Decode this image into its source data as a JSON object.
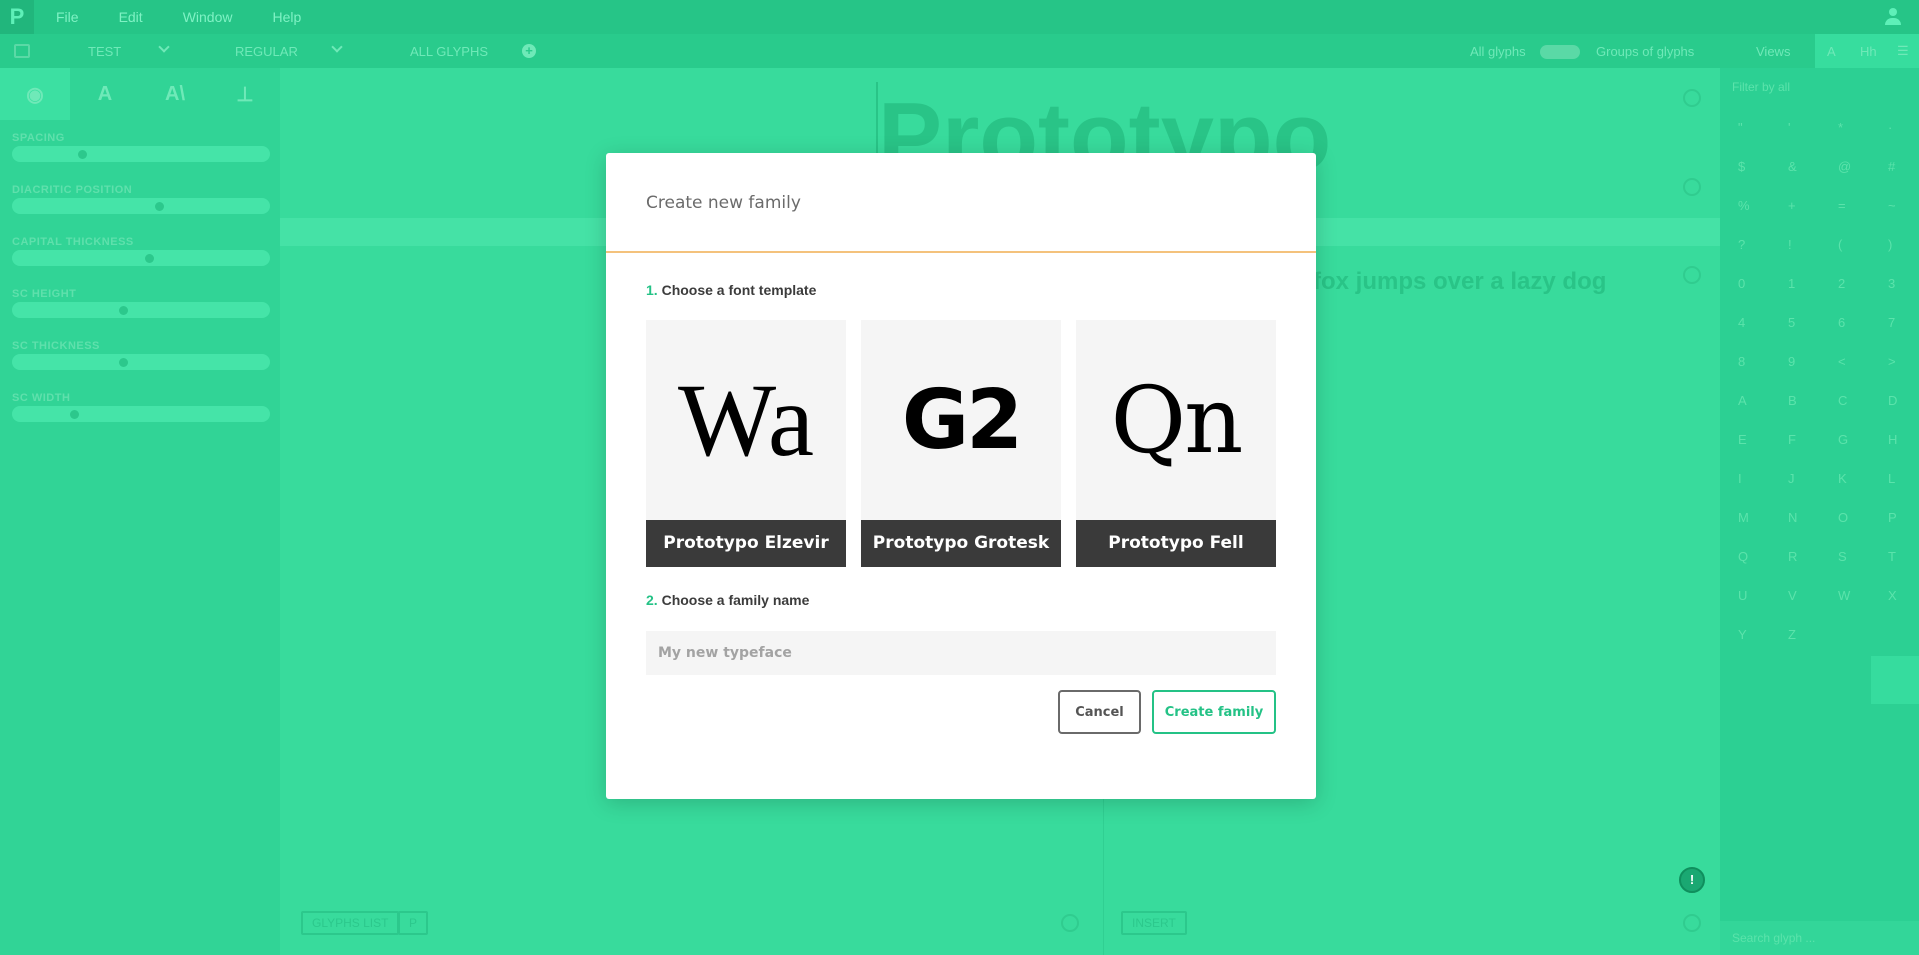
{
  "menubar": {
    "logo": "P",
    "items": [
      "File",
      "Edit",
      "Window",
      "Help"
    ]
  },
  "toolbar": {
    "family": "TEST",
    "variant": "REGULAR",
    "glyph_filter": "ALL GLYPHS",
    "toggle_left": "All glyphs",
    "toggle_right": "Groups of glyphs",
    "views": "Views",
    "view_a": "A",
    "view_b": "Hh"
  },
  "left_panel": {
    "sliders": [
      {
        "label": "SPACING",
        "level": 0.27
      },
      {
        "label": "DIACRITIC POSITION",
        "level": 0.57
      },
      {
        "label": "CAPITAL THICKNESS",
        "level": 0.53
      },
      {
        "label": "SC HEIGHT",
        "level": 0.43
      },
      {
        "label": "SC THICKNESS",
        "level": 0.43
      },
      {
        "label": "SC WIDTH",
        "level": 0.24
      }
    ]
  },
  "main": {
    "preview_text": "Prototypo",
    "sample_text": "fox jumps over a lazy dog",
    "glyphs_list_label": "GLYPHS LIST",
    "current_glyph": "P",
    "insert_label": "INSERT"
  },
  "right_panel": {
    "filter_placeholder": "Filter by all",
    "glyphs": [
      "\"",
      "'",
      "*",
      "·",
      "$",
      "&",
      "@",
      "#",
      "%",
      "+",
      "=",
      "~",
      "?",
      "!",
      "(",
      ")",
      "0",
      "1",
      "2",
      "3",
      "4",
      "5",
      "6",
      "7",
      "8",
      "9",
      "<",
      ">",
      "A",
      "B",
      "C",
      "D",
      "E",
      "F",
      "G",
      "H",
      "I",
      "J",
      "K",
      "L",
      "M",
      "N",
      "O",
      "P",
      "Q",
      "R",
      "S",
      "T",
      "U",
      "V",
      "W",
      "X",
      "Y",
      "Z"
    ],
    "search_placeholder": "Search glyph ..."
  },
  "modal": {
    "title": "Create new family",
    "step1_num": "1.",
    "step1_label": "Choose a font template",
    "templates": [
      {
        "sample": "Wa",
        "name": "Prototypo Elzevir"
      },
      {
        "sample": "G2",
        "name": "Prototypo Grotesk"
      },
      {
        "sample": "Qn",
        "name": "Prototypo Fell"
      }
    ],
    "step2_num": "2.",
    "step2_label": "Choose a family name",
    "name_placeholder": "My new typeface",
    "cancel_label": "Cancel",
    "create_label": "Create family"
  },
  "colors": {
    "accent": "#24c286",
    "background_green": "#2fd496",
    "modal_rule": "#f4c27c",
    "template_label_bg": "#3a3a3a"
  }
}
